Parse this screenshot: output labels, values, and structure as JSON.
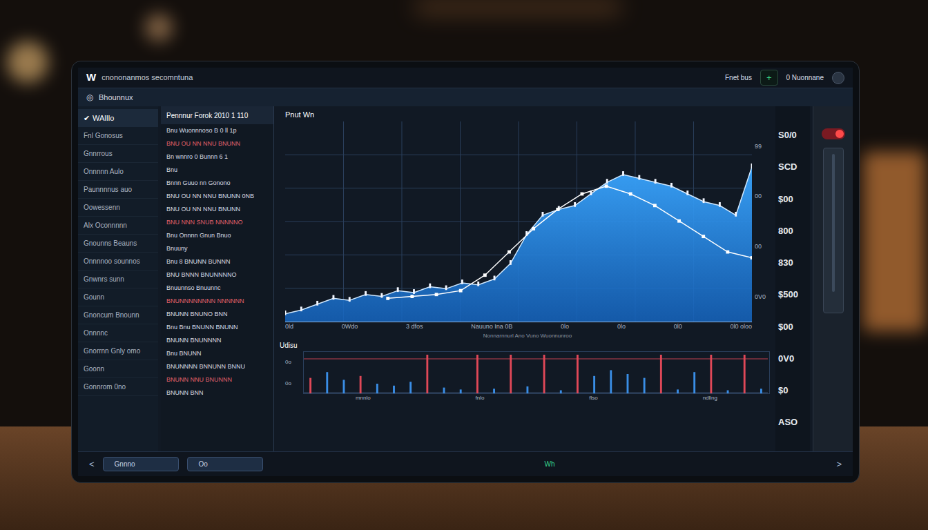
{
  "window": {
    "logo": "W",
    "title": "cnononanmos secomntuna",
    "header_right": {
      "label": "Fnet bus",
      "add": "+",
      "account": "0 Nuonnane"
    }
  },
  "subheader": {
    "icon": "◎",
    "title": "Bhounnux"
  },
  "sidebar": {
    "items": [
      {
        "label": "WAlIlo",
        "mark": "✔",
        "selected": true
      },
      {
        "label": "Fnl Gonosus",
        "mark": "",
        "selected": false
      },
      {
        "label": "Gnnrrous",
        "mark": "",
        "selected": false
      },
      {
        "label": "Onnnnn Aulo",
        "mark": "",
        "selected": false
      },
      {
        "label": "Paunnnnus auo",
        "mark": "",
        "selected": false
      },
      {
        "label": "Oowessenn",
        "mark": "",
        "selected": false
      },
      {
        "label": "Alx Oconnnnn",
        "mark": "",
        "selected": false
      },
      {
        "label": "Gnounns Beauns",
        "mark": "",
        "selected": false
      },
      {
        "label": "Onnnnoo sounnos",
        "mark": "",
        "selected": false
      },
      {
        "label": "Gnwnrs sunn",
        "mark": "",
        "selected": false
      },
      {
        "label": "Gounn",
        "mark": "",
        "selected": false
      },
      {
        "label": "Gnoncum Bnounn",
        "mark": "",
        "selected": false
      },
      {
        "label": "Onnnnc",
        "mark": "",
        "selected": false
      },
      {
        "label": "Gnorrnn Gnly omo",
        "mark": "",
        "selected": false
      },
      {
        "label": "Goonn",
        "mark": "",
        "selected": false
      },
      {
        "label": "Gonnrom 0no",
        "mark": "",
        "selected": false
      }
    ]
  },
  "list": {
    "title": "Pennnur Forok 2010 1 110",
    "rows": [
      {
        "text": "Bnu Wuonnnoso B 0 ll 1p",
        "color": "#d8dde6"
      },
      {
        "text": "BNU OU NN NNU BNUNN",
        "color": "#e0606a"
      },
      {
        "text": "Bn wnnro 0 Bunnn 6 1",
        "color": "#d8dde6"
      },
      {
        "text": "Bnu",
        "color": "#d8dde6"
      },
      {
        "text": "Bnnn Guuo nn Gonono",
        "color": "#d8dde6"
      },
      {
        "text": "BNU OU NN NNU BNUNN 0NB",
        "color": "#d8dde6"
      },
      {
        "text": "BNU OU NN NNU BNUNN",
        "color": "#d8dde6"
      },
      {
        "text": "BNU NNN SNUB NNNNNO",
        "color": "#e0606a"
      },
      {
        "text": "Bnu Onnnn Gnun Bnuo",
        "color": "#d8dde6"
      },
      {
        "text": "Bnuuny",
        "color": "#d8dde6"
      },
      {
        "text": "Bnu 8 BNUNN BUNNN",
        "color": "#d8dde6"
      },
      {
        "text": "BNU BNNN BNUNNNNO",
        "color": "#d8dde6"
      },
      {
        "text": "Bnuunnso Bnuunnc",
        "color": "#d8dde6"
      },
      {
        "text": "BNUNNNNNNNN NNNNNN",
        "color": "#e0606a"
      },
      {
        "text": "BNUNN BNUNO BNN",
        "color": "#d8dde6"
      },
      {
        "text": "Bnu Bnu BNUNN BNUNN",
        "color": "#d8dde6"
      },
      {
        "text": "BNUNN BNUNNNN",
        "color": "#d8dde6"
      },
      {
        "text": "Bnu BNUNN",
        "color": "#d8dde6"
      },
      {
        "text": "BNUNNNN BNNUNN BNNU",
        "color": "#d8dde6"
      },
      {
        "text": "BNUNN NNU BNUNNN",
        "color": "#e0606a"
      },
      {
        "text": "BNUNN BNN",
        "color": "#d8dde6"
      }
    ]
  },
  "chart": {
    "title": "Pnut Wn",
    "area": [
      4,
      6,
      9,
      12,
      11,
      14,
      13,
      16,
      15,
      18,
      17,
      20,
      19,
      22,
      30,
      45,
      55,
      58,
      60,
      66,
      72,
      76,
      74,
      72,
      70,
      66,
      62,
      60,
      55,
      80
    ],
    "line": [
      12,
      13,
      14,
      16,
      24,
      36,
      48,
      58,
      66,
      70,
      66,
      60,
      52,
      44,
      36,
      33
    ],
    "inner_ticks": [
      "99",
      "00",
      "00",
      "0V0"
    ],
    "x_labels": [
      "0ld",
      "0Wdo",
      "3 dfos",
      "Nauuno Ina 0B",
      "0lo",
      "0lo",
      "0l0",
      "0l0 oloo"
    ],
    "caption": "Nonnarnnurl Ano Vuno Wuonnunroo"
  },
  "axis": {
    "ticks": [
      "S0/0",
      "SCD",
      "$00",
      "800",
      "830",
      "$500",
      "$00",
      "0V0",
      "$0",
      "ASO"
    ]
  },
  "lower_chart": {
    "title": "Udisu",
    "ticks": [
      "0o",
      "0o"
    ],
    "bars": [
      {
        "value": 40,
        "color": "#e04858"
      },
      {
        "value": 55,
        "color": "#3a8ee6"
      },
      {
        "value": 35,
        "color": "#3a8ee6"
      },
      {
        "value": 45,
        "color": "#e04858"
      },
      {
        "value": 25,
        "color": "#3a8ee6"
      },
      {
        "value": 20,
        "color": "#3a8ee6"
      },
      {
        "value": 30,
        "color": "#3a8ee6"
      },
      {
        "value": 100,
        "color": "#e04858"
      },
      {
        "value": 15,
        "color": "#3a8ee6"
      },
      {
        "value": 10,
        "color": "#3a8ee6"
      },
      {
        "value": 100,
        "color": "#e04858"
      },
      {
        "value": 12,
        "color": "#3a8ee6"
      },
      {
        "value": 100,
        "color": "#e04858"
      },
      {
        "value": 18,
        "color": "#3a8ee6"
      },
      {
        "value": 100,
        "color": "#e04858"
      },
      {
        "value": 8,
        "color": "#3a8ee6"
      },
      {
        "value": 100,
        "color": "#e04858"
      },
      {
        "value": 45,
        "color": "#3a8ee6"
      },
      {
        "value": 60,
        "color": "#3a8ee6"
      },
      {
        "value": 50,
        "color": "#3a8ee6"
      },
      {
        "value": 40,
        "color": "#3a8ee6"
      },
      {
        "value": 100,
        "color": "#e04858"
      },
      {
        "value": 10,
        "color": "#3a8ee6"
      },
      {
        "value": 55,
        "color": "#3a8ee6"
      },
      {
        "value": 100,
        "color": "#e04858"
      },
      {
        "value": 8,
        "color": "#3a8ee6"
      },
      {
        "value": 100,
        "color": "#e04858"
      },
      {
        "value": 12,
        "color": "#3a8ee6"
      }
    ],
    "x_labels": [
      "mnnlo",
      "fnlo",
      "flso",
      "ndling"
    ]
  },
  "side_panel": {
    "toggle_on": true
  },
  "bottom_bar": {
    "prev": "<",
    "buttons": [
      "Gnnno",
      "Oo"
    ],
    "center": "Wh",
    "next": ">"
  }
}
